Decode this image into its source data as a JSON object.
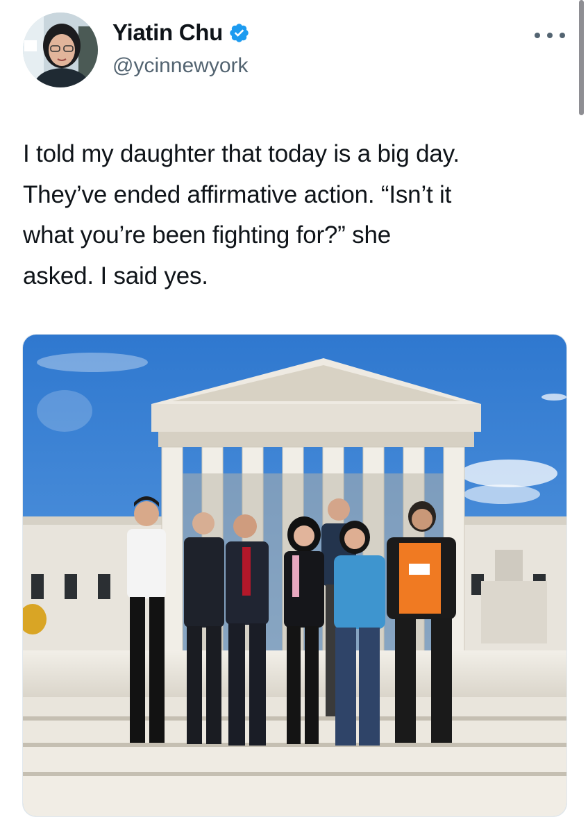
{
  "user": {
    "display_name": "Yiatin Chu",
    "handle": "@ycinnewyork",
    "verified": true,
    "verified_color": "#1d9bf0",
    "avatar_icon": "profile-photo"
  },
  "tweet": {
    "text_lines": [
      "I told my daughter that today is a big day.",
      "They’ve ended affirmative action. “Isn’t it",
      "what you’re been fighting for?” she",
      "asked. I said yes."
    ]
  },
  "media": {
    "subject": "group-photo-on-courthouse-steps",
    "sky_color": "#3d86d6",
    "stone_color": "#e9e5dc"
  },
  "icons": {
    "more": "more-options-icon",
    "verified": "verified-badge-icon"
  }
}
